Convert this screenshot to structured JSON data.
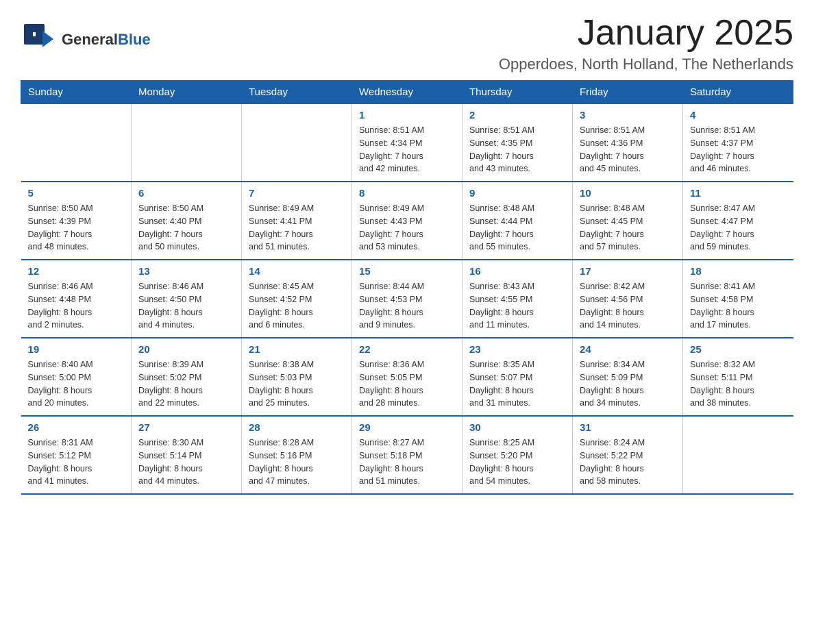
{
  "logo": {
    "text_general": "General",
    "text_blue": "Blue",
    "arrow": "▶"
  },
  "title": "January 2025",
  "subtitle": "Opperdoes, North Holland, The Netherlands",
  "days_of_week": [
    "Sunday",
    "Monday",
    "Tuesday",
    "Wednesday",
    "Thursday",
    "Friday",
    "Saturday"
  ],
  "weeks": [
    [
      {
        "day": "",
        "info": ""
      },
      {
        "day": "",
        "info": ""
      },
      {
        "day": "",
        "info": ""
      },
      {
        "day": "1",
        "info": "Sunrise: 8:51 AM\nSunset: 4:34 PM\nDaylight: 7 hours\nand 42 minutes."
      },
      {
        "day": "2",
        "info": "Sunrise: 8:51 AM\nSunset: 4:35 PM\nDaylight: 7 hours\nand 43 minutes."
      },
      {
        "day": "3",
        "info": "Sunrise: 8:51 AM\nSunset: 4:36 PM\nDaylight: 7 hours\nand 45 minutes."
      },
      {
        "day": "4",
        "info": "Sunrise: 8:51 AM\nSunset: 4:37 PM\nDaylight: 7 hours\nand 46 minutes."
      }
    ],
    [
      {
        "day": "5",
        "info": "Sunrise: 8:50 AM\nSunset: 4:39 PM\nDaylight: 7 hours\nand 48 minutes."
      },
      {
        "day": "6",
        "info": "Sunrise: 8:50 AM\nSunset: 4:40 PM\nDaylight: 7 hours\nand 50 minutes."
      },
      {
        "day": "7",
        "info": "Sunrise: 8:49 AM\nSunset: 4:41 PM\nDaylight: 7 hours\nand 51 minutes."
      },
      {
        "day": "8",
        "info": "Sunrise: 8:49 AM\nSunset: 4:43 PM\nDaylight: 7 hours\nand 53 minutes."
      },
      {
        "day": "9",
        "info": "Sunrise: 8:48 AM\nSunset: 4:44 PM\nDaylight: 7 hours\nand 55 minutes."
      },
      {
        "day": "10",
        "info": "Sunrise: 8:48 AM\nSunset: 4:45 PM\nDaylight: 7 hours\nand 57 minutes."
      },
      {
        "day": "11",
        "info": "Sunrise: 8:47 AM\nSunset: 4:47 PM\nDaylight: 7 hours\nand 59 minutes."
      }
    ],
    [
      {
        "day": "12",
        "info": "Sunrise: 8:46 AM\nSunset: 4:48 PM\nDaylight: 8 hours\nand 2 minutes."
      },
      {
        "day": "13",
        "info": "Sunrise: 8:46 AM\nSunset: 4:50 PM\nDaylight: 8 hours\nand 4 minutes."
      },
      {
        "day": "14",
        "info": "Sunrise: 8:45 AM\nSunset: 4:52 PM\nDaylight: 8 hours\nand 6 minutes."
      },
      {
        "day": "15",
        "info": "Sunrise: 8:44 AM\nSunset: 4:53 PM\nDaylight: 8 hours\nand 9 minutes."
      },
      {
        "day": "16",
        "info": "Sunrise: 8:43 AM\nSunset: 4:55 PM\nDaylight: 8 hours\nand 11 minutes."
      },
      {
        "day": "17",
        "info": "Sunrise: 8:42 AM\nSunset: 4:56 PM\nDaylight: 8 hours\nand 14 minutes."
      },
      {
        "day": "18",
        "info": "Sunrise: 8:41 AM\nSunset: 4:58 PM\nDaylight: 8 hours\nand 17 minutes."
      }
    ],
    [
      {
        "day": "19",
        "info": "Sunrise: 8:40 AM\nSunset: 5:00 PM\nDaylight: 8 hours\nand 20 minutes."
      },
      {
        "day": "20",
        "info": "Sunrise: 8:39 AM\nSunset: 5:02 PM\nDaylight: 8 hours\nand 22 minutes."
      },
      {
        "day": "21",
        "info": "Sunrise: 8:38 AM\nSunset: 5:03 PM\nDaylight: 8 hours\nand 25 minutes."
      },
      {
        "day": "22",
        "info": "Sunrise: 8:36 AM\nSunset: 5:05 PM\nDaylight: 8 hours\nand 28 minutes."
      },
      {
        "day": "23",
        "info": "Sunrise: 8:35 AM\nSunset: 5:07 PM\nDaylight: 8 hours\nand 31 minutes."
      },
      {
        "day": "24",
        "info": "Sunrise: 8:34 AM\nSunset: 5:09 PM\nDaylight: 8 hours\nand 34 minutes."
      },
      {
        "day": "25",
        "info": "Sunrise: 8:32 AM\nSunset: 5:11 PM\nDaylight: 8 hours\nand 38 minutes."
      }
    ],
    [
      {
        "day": "26",
        "info": "Sunrise: 8:31 AM\nSunset: 5:12 PM\nDaylight: 8 hours\nand 41 minutes."
      },
      {
        "day": "27",
        "info": "Sunrise: 8:30 AM\nSunset: 5:14 PM\nDaylight: 8 hours\nand 44 minutes."
      },
      {
        "day": "28",
        "info": "Sunrise: 8:28 AM\nSunset: 5:16 PM\nDaylight: 8 hours\nand 47 minutes."
      },
      {
        "day": "29",
        "info": "Sunrise: 8:27 AM\nSunset: 5:18 PM\nDaylight: 8 hours\nand 51 minutes."
      },
      {
        "day": "30",
        "info": "Sunrise: 8:25 AM\nSunset: 5:20 PM\nDaylight: 8 hours\nand 54 minutes."
      },
      {
        "day": "31",
        "info": "Sunrise: 8:24 AM\nSunset: 5:22 PM\nDaylight: 8 hours\nand 58 minutes."
      },
      {
        "day": "",
        "info": ""
      }
    ]
  ]
}
